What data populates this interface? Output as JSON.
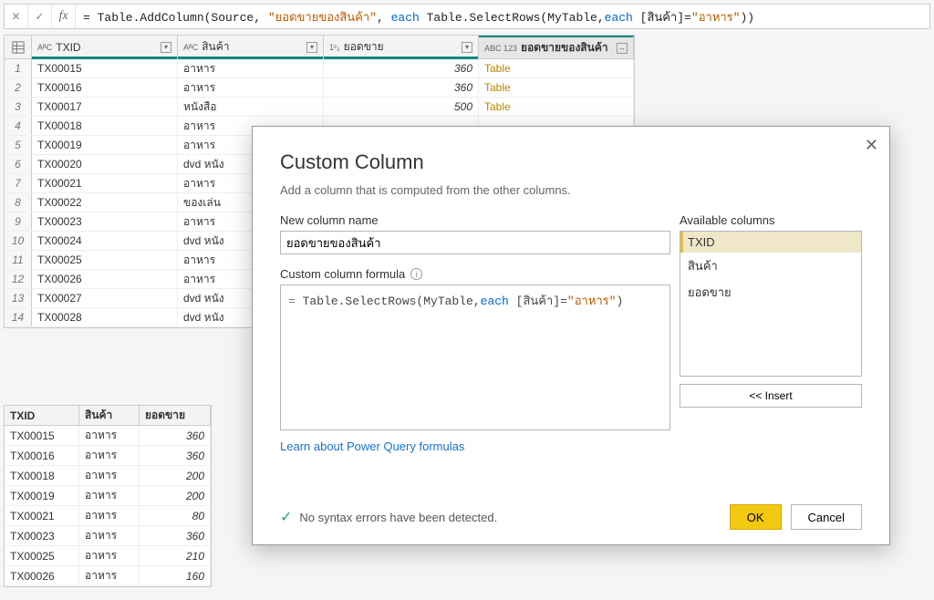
{
  "formula_bar": {
    "prefix": "= Table.AddColumn(Source, ",
    "arg_str": "\"ยอดขายของสินค้า\"",
    "mid": ", ",
    "each": "each",
    "mid2": " Table.SelectRows(MyTable,",
    "each2": "each",
    "mid3": " [สินค้า]=",
    "val_str": "\"อาหาร\"",
    "suffix": "))"
  },
  "grid": {
    "col_txid_type": "AᴮC",
    "col_txid": "TXID",
    "col_prod_type": "AᴮC",
    "col_prod": "สินค้า",
    "col_sales_type": "1²₃",
    "col_sales": "ยอดขาย",
    "col_new_type": "ABC\n123",
    "col_new": "ยอดขายของสินค้า",
    "rows": [
      {
        "n": "1",
        "txid": "TX00015",
        "prod": "อาหาร",
        "sales": "360",
        "new": "Table"
      },
      {
        "n": "2",
        "txid": "TX00016",
        "prod": "อาหาร",
        "sales": "360",
        "new": "Table"
      },
      {
        "n": "3",
        "txid": "TX00017",
        "prod": "หนังสือ",
        "sales": "500",
        "new": "Table"
      },
      {
        "n": "4",
        "txid": "TX00018",
        "prod": "อาหาร",
        "sales": "",
        "new": ""
      },
      {
        "n": "5",
        "txid": "TX00019",
        "prod": "อาหาร",
        "sales": "",
        "new": ""
      },
      {
        "n": "6",
        "txid": "TX00020",
        "prod": "dvd หนัง",
        "sales": "",
        "new": ""
      },
      {
        "n": "7",
        "txid": "TX00021",
        "prod": "อาหาร",
        "sales": "",
        "new": ""
      },
      {
        "n": "8",
        "txid": "TX00022",
        "prod": "ของเล่น",
        "sales": "",
        "new": ""
      },
      {
        "n": "9",
        "txid": "TX00023",
        "prod": "อาหาร",
        "sales": "",
        "new": ""
      },
      {
        "n": "10",
        "txid": "TX00024",
        "prod": "dvd หนัง",
        "sales": "",
        "new": ""
      },
      {
        "n": "11",
        "txid": "TX00025",
        "prod": "อาหาร",
        "sales": "",
        "new": ""
      },
      {
        "n": "12",
        "txid": "TX00026",
        "prod": "อาหาร",
        "sales": "",
        "new": ""
      },
      {
        "n": "13",
        "txid": "TX00027",
        "prod": "dvd หนัง",
        "sales": "",
        "new": ""
      },
      {
        "n": "14",
        "txid": "TX00028",
        "prod": "dvd หนัง",
        "sales": "",
        "new": ""
      }
    ]
  },
  "mini": {
    "h_txid": "TXID",
    "h_prod": "สินค้า",
    "h_sales": "ยอดขาย",
    "rows": [
      {
        "a": "TX00015",
        "b": "อาหาร",
        "c": "360"
      },
      {
        "a": "TX00016",
        "b": "อาหาร",
        "c": "360"
      },
      {
        "a": "TX00018",
        "b": "อาหาร",
        "c": "200"
      },
      {
        "a": "TX00019",
        "b": "อาหาร",
        "c": "200"
      },
      {
        "a": "TX00021",
        "b": "อาหาร",
        "c": "80"
      },
      {
        "a": "TX00023",
        "b": "อาหาร",
        "c": "360"
      },
      {
        "a": "TX00025",
        "b": "อาหาร",
        "c": "210"
      },
      {
        "a": "TX00026",
        "b": "อาหาร",
        "c": "160"
      }
    ]
  },
  "dialog": {
    "title": "Custom Column",
    "subtitle": "Add a column that is computed from the other columns.",
    "name_label": "New column name",
    "name_value": "ยอดขายของสินค้า",
    "formula_label": "Custom column formula",
    "formula_eq": "= ",
    "formula_body1": "Table.SelectRows(MyTable,",
    "formula_each": "each",
    "formula_body2": " [สินค้า]=",
    "formula_str": "\"อาหาร\"",
    "formula_body3": ")",
    "avail_label": "Available columns",
    "avail_items": [
      "TXID",
      "สินค้า",
      "ยอดขาย"
    ],
    "insert_label": "<< Insert",
    "learn_link": "Learn about Power Query formulas",
    "syntax_ok": "No syntax errors have been detected.",
    "ok": "OK",
    "cancel": "Cancel"
  }
}
